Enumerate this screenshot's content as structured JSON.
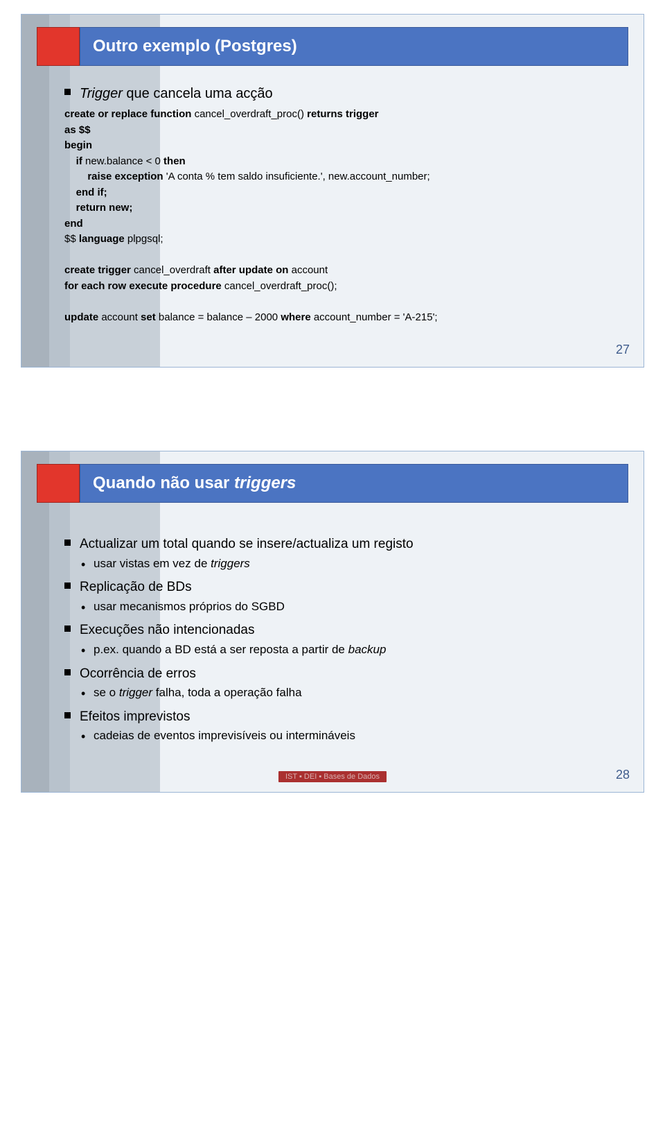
{
  "slide1": {
    "title": "Outro exemplo (Postgres)",
    "bullet_intro_pre": "Trigger",
    "bullet_intro_post": " que cancela uma acção",
    "code": {
      "l1a": "create or replace function",
      "l1b": " cancel_overdraft_proc() ",
      "l1c": "returns trigger",
      "l2": "as $$",
      "l3": "begin",
      "l4a": "    if",
      "l4b": " new.balance < 0 ",
      "l4c": "then",
      "l5a": "        raise exception",
      "l5b": " 'A conta % tem saldo insuficiente.', new.account_number;",
      "l6": "    end if;",
      "l7": "    return new;",
      "l8": "end",
      "l9a": "$$ ",
      "l9b": "language",
      "l9c": " plpgsql;",
      "l10a": "create trigger",
      "l10b": " cancel_overdraft ",
      "l10c": "after update on",
      "l10d": " account",
      "l11a": "for each row execute procedure",
      "l11b": " cancel_overdraft_proc();",
      "l12a": "update",
      "l12b": " account ",
      "l12c": "set",
      "l12d": " balance = balance – 2000 ",
      "l12e": "where",
      "l12f": " account_number = 'A-215';"
    },
    "page_num": "27"
  },
  "slide2": {
    "title_pre": "Quando não usar ",
    "title_it": "triggers",
    "items": [
      {
        "text": "Actualizar um total quando se insere/actualiza um registo",
        "sub_pre": "usar vistas em vez de ",
        "sub_it": "triggers"
      },
      {
        "text": "Replicação de BDs",
        "sub": "usar mecanismos próprios do SGBD"
      },
      {
        "text": "Execuções não intencionadas",
        "sub_pre": "p.ex. quando a BD está a ser reposta a partir de ",
        "sub_it": "backup"
      },
      {
        "text": "Ocorrência de erros",
        "sub_pre": "se o ",
        "sub_it": "trigger",
        "sub_post": " falha, toda a operação falha"
      },
      {
        "text": "Efeitos imprevistos",
        "sub": "cadeias de eventos imprevisíveis ou intermináveis"
      }
    ],
    "page_num": "28",
    "footer": "IST ▪ DEI ▪ Bases de Dados"
  }
}
